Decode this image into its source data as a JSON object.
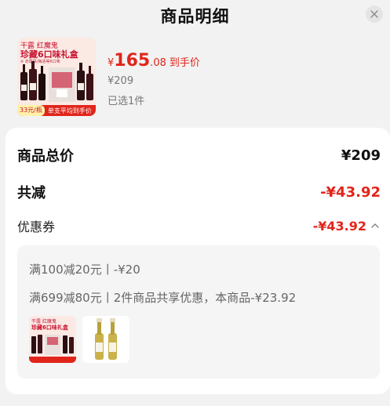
{
  "header": {
    "title": "商品明细",
    "close_icon": "close-icon"
  },
  "product": {
    "thumb": {
      "brand": "干露 红魔鬼",
      "name": "珍藏6口味礼盒",
      "subtitle": "※ 赤霞珠/梅洛等6口味",
      "foot_tag": "33元/瓶",
      "foot_text": "单支平均到手价"
    },
    "price_currency": "¥",
    "price_int": "165",
    "price_dec": ".08",
    "price_label": "到手价",
    "original_price": "¥209",
    "quantity_text": "已选1件"
  },
  "summary": {
    "total_label": "商品总价",
    "total_value": "¥209",
    "reduce_label": "共减",
    "reduce_value": "-¥43.92",
    "coupon_label": "优惠券",
    "coupon_value": "-¥43.92",
    "coupon_toggle_icon": "chevron-up-icon"
  },
  "coupon_detail": {
    "line1": "满100减20元丨-¥20",
    "line2": "满699减80元丨2件商品共享优惠，本商品-¥23.92",
    "items": [
      {
        "name": "珍藏6口味礼盒",
        "brand": "干露 红魔鬼"
      },
      {
        "name": "white-wine-two-bottles"
      }
    ]
  },
  "colors": {
    "accent": "#e1251b",
    "background": "#f2f2f2",
    "card": "#ffffff"
  }
}
